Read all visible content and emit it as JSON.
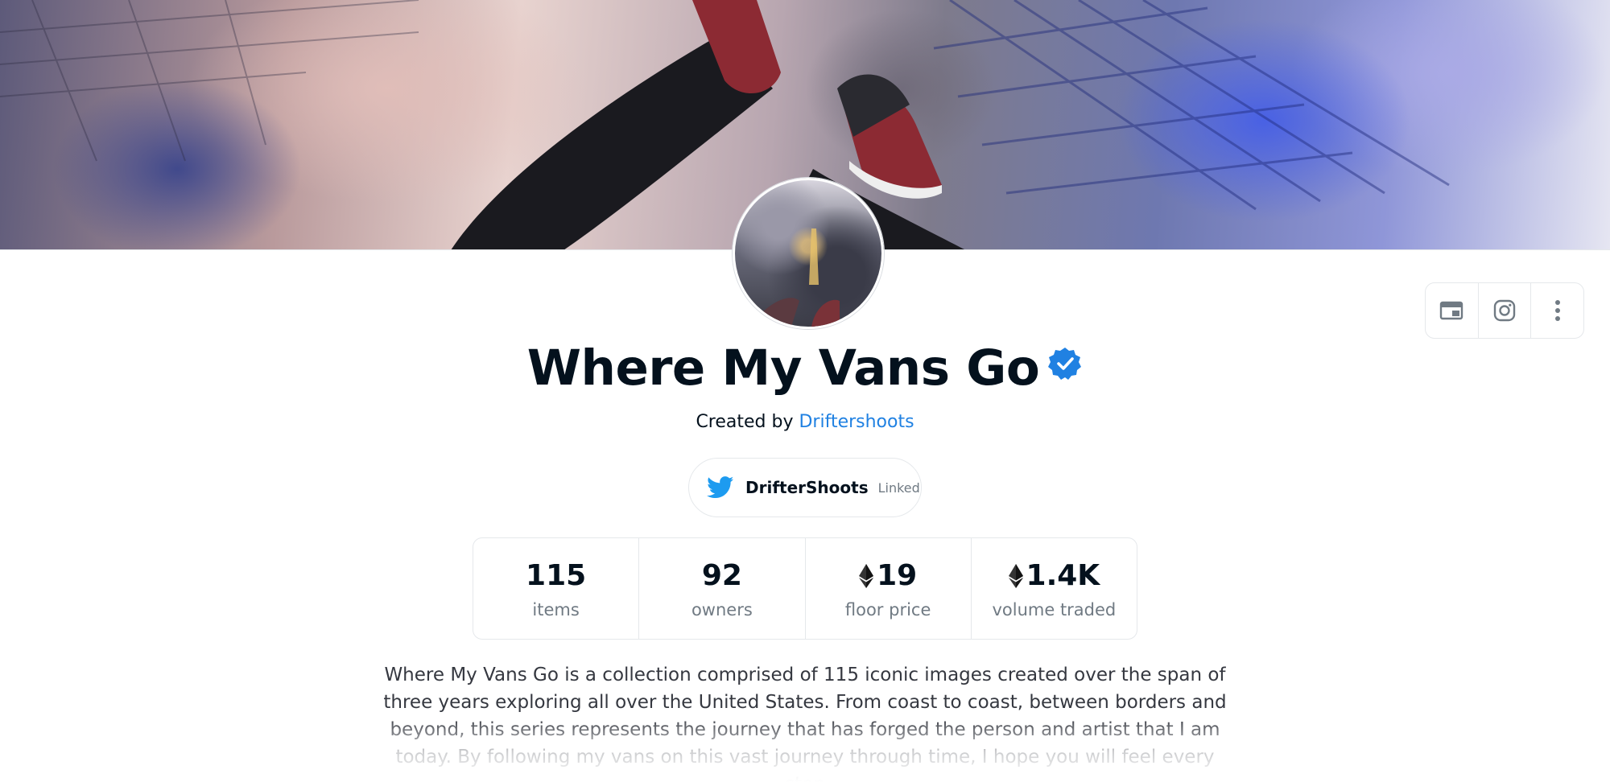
{
  "collection": {
    "name": "Where My Vans Go",
    "verified": true,
    "created_by_prefix": "Created by",
    "creator": "Driftershoots"
  },
  "twitter": {
    "handle": "DrifterShoots",
    "status": "Linked",
    "icon": "twitter-bird-icon",
    "color": "#1d9bf0"
  },
  "actions": [
    {
      "name": "website",
      "icon": "website-icon"
    },
    {
      "name": "instagram",
      "icon": "instagram-icon"
    },
    {
      "name": "more",
      "icon": "more-vertical-icon"
    }
  ],
  "stats": [
    {
      "value": "115",
      "label": "items",
      "eth": false
    },
    {
      "value": "92",
      "label": "owners",
      "eth": false
    },
    {
      "value": "19",
      "label": "floor price",
      "eth": true
    },
    {
      "value": "1.4K",
      "label": "volume traded",
      "eth": true
    }
  ],
  "description": "Where My Vans Go is a collection comprised of 115 iconic images created over the span of three years exploring all over the United States. From coast to coast, between borders and beyond, this series represents the journey that has forged the person and artist that I am today. By following my vans on this vast journey through time, I hope you will feel every step",
  "colors": {
    "link": "#2081e2",
    "verified": "#2081e2",
    "text": "#04111d",
    "muted": "#707a83",
    "border": "#e5e8eb"
  }
}
